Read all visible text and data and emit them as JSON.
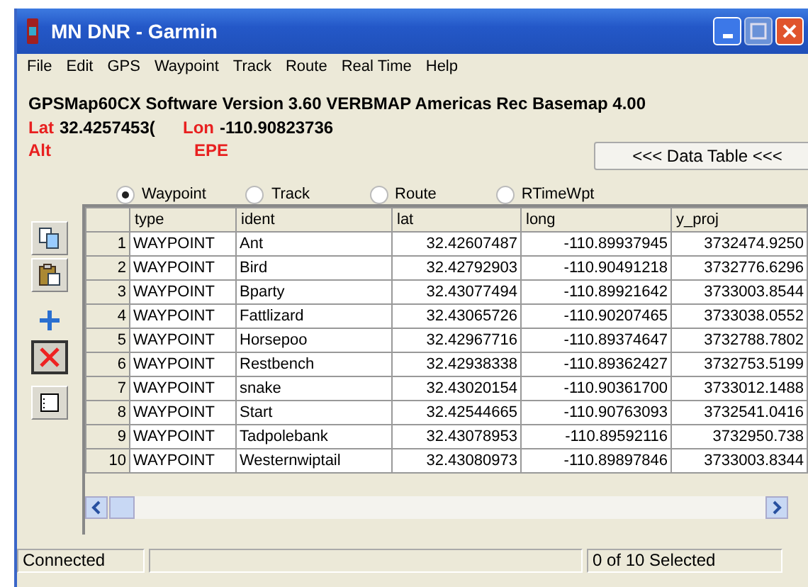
{
  "window": {
    "title": "MN DNR - Garmin"
  },
  "menu": [
    "File",
    "Edit",
    "GPS",
    "Waypoint",
    "Track",
    "Route",
    "Real Time",
    "Help"
  ],
  "info": {
    "version": "GPSMap60CX Software Version 3.60 VERBMAP Americas Rec Basemap 4.00",
    "lat_label": "Lat",
    "lat_value": "32.4257453(",
    "lon_label": "Lon",
    "lon_value": "-110.90823736",
    "alt_label": "Alt",
    "epe_label": "EPE"
  },
  "data_table_button": "<<< Data Table <<<",
  "modes": [
    {
      "label": "Waypoint",
      "selected": true
    },
    {
      "label": "Track",
      "selected": false
    },
    {
      "label": "Route",
      "selected": false
    },
    {
      "label": "RTimeWpt",
      "selected": false
    }
  ],
  "table": {
    "columns": [
      "type",
      "ident",
      "lat",
      "long",
      "y_proj"
    ],
    "rows": [
      {
        "n": "1",
        "cells": [
          "WAYPOINT",
          "Ant",
          "32.42607487",
          "-110.89937945",
          "3732474.9250"
        ]
      },
      {
        "n": "2",
        "cells": [
          "WAYPOINT",
          "Bird",
          "32.42792903",
          "-110.90491218",
          "3732776.6296"
        ]
      },
      {
        "n": "3",
        "cells": [
          "WAYPOINT",
          "Bparty",
          "32.43077494",
          "-110.89921642",
          "3733003.8544"
        ]
      },
      {
        "n": "4",
        "cells": [
          "WAYPOINT",
          "Fattlizard",
          "32.43065726",
          "-110.90207465",
          "3733038.0552"
        ]
      },
      {
        "n": "5",
        "cells": [
          "WAYPOINT",
          "Horsepoo",
          "32.42967716",
          "-110.89374647",
          "3732788.7802"
        ]
      },
      {
        "n": "6",
        "cells": [
          "WAYPOINT",
          "Restbench",
          "32.42938338",
          "-110.89362427",
          "3732753.5199"
        ]
      },
      {
        "n": "7",
        "cells": [
          "WAYPOINT",
          "snake",
          "32.43020154",
          "-110.90361700",
          "3733012.1488"
        ]
      },
      {
        "n": "8",
        "cells": [
          "WAYPOINT",
          "Start",
          "32.42544665",
          "-110.90763093",
          "3732541.0416"
        ]
      },
      {
        "n": "9",
        "cells": [
          "WAYPOINT",
          "Tadpolebank",
          "32.43078953",
          "-110.89592116",
          "3732950.738"
        ]
      },
      {
        "n": "10",
        "cells": [
          "WAYPOINT",
          "Westernwiptail",
          "32.43080973",
          "-110.89897846",
          "3733003.8344"
        ]
      }
    ]
  },
  "status_bar": {
    "left": "Connected",
    "right": "0 of 10 Selected"
  }
}
